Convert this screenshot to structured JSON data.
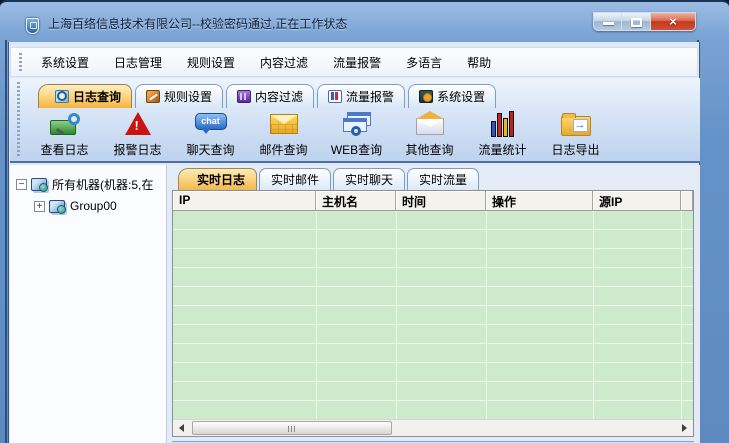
{
  "window": {
    "title": "上海百络信息技术有限公司--校验密码通过,正在工作状态"
  },
  "icons": {
    "close": "×",
    "alarm_bang": "!",
    "chat_text": "chat",
    "export_arrow": "→",
    "tree_collapse": "−",
    "tree_expand": "+"
  },
  "menu": {
    "items": [
      "系统设置",
      "日志管理",
      "规则设置",
      "内容过滤",
      "流量报警",
      "多语言",
      "帮助"
    ]
  },
  "main_tabs": [
    {
      "label": "日志查询",
      "active": true
    },
    {
      "label": "规则设置",
      "active": false
    },
    {
      "label": "内容过滤",
      "active": false
    },
    {
      "label": "流量报警",
      "active": false
    },
    {
      "label": "系统设置",
      "active": false
    }
  ],
  "toolbar": [
    {
      "label": "查看日志"
    },
    {
      "label": "报警日志"
    },
    {
      "label": "聊天查询"
    },
    {
      "label": "邮件查询"
    },
    {
      "label": "WEB查询"
    },
    {
      "label": "其他查询"
    },
    {
      "label": "流量统计"
    },
    {
      "label": "日志导出"
    }
  ],
  "tree": {
    "root": "所有机器(机器:5,在",
    "children": [
      "Group00"
    ]
  },
  "log_tabs": [
    {
      "label": "实时日志",
      "active": true
    },
    {
      "label": "实时邮件",
      "active": false
    },
    {
      "label": "实时聊天",
      "active": false
    },
    {
      "label": "实时流量",
      "active": false
    }
  ],
  "table": {
    "columns": [
      "IP",
      "主机名",
      "时间",
      "操作",
      "源IP"
    ],
    "rows": []
  },
  "colors": {
    "titlebar": "#7aa3d4",
    "active_tab": "#f6b23f",
    "table_body": "#cdeacd",
    "band_top": "#edf4fd",
    "band_bottom": "#bed3ee"
  }
}
